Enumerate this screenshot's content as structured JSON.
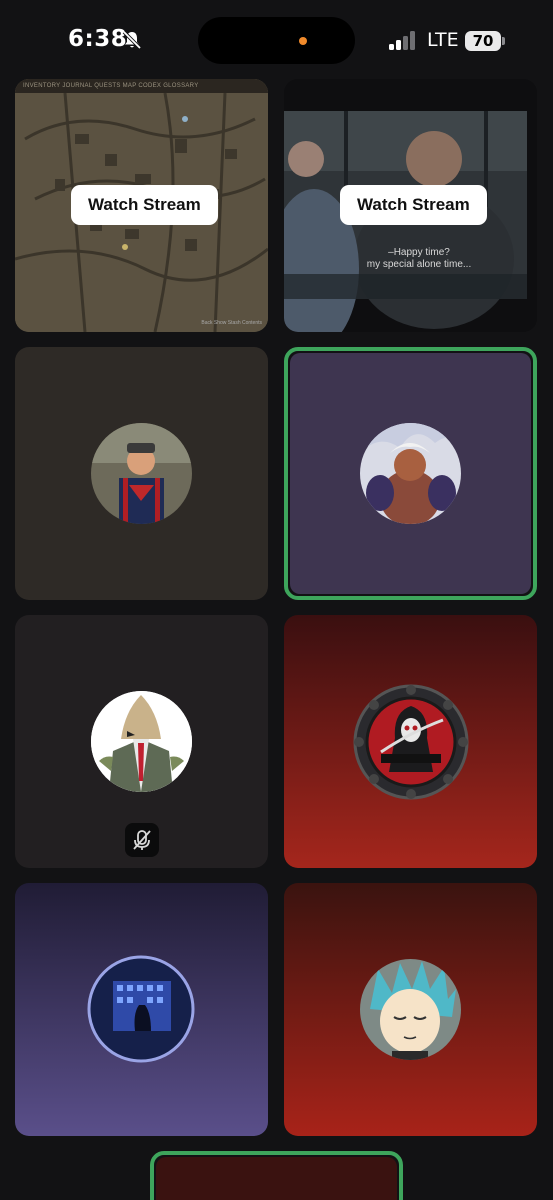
{
  "status_bar": {
    "time": "6:38",
    "carrier": "LTE",
    "battery": "70",
    "icons": [
      "bell-slash-icon",
      "cellular-signal-icon",
      "battery-icon"
    ]
  },
  "streams": [
    {
      "watch_label": "Watch Stream",
      "preview": "game-map",
      "map_tabs": "INVENTORY   JOURNAL   QUESTS   MAP   CODEX   GLOSSARY",
      "map_footer": "Back   Show Stash Contents"
    },
    {
      "watch_label": "Watch Stream",
      "preview": "video",
      "subtitle_line1": "–Happy time?",
      "subtitle_line2": "my special alone time..."
    }
  ],
  "participants": [
    {
      "avatar": "person-icon",
      "speaking": false,
      "muted": false
    },
    {
      "avatar": "person-icon",
      "speaking": true,
      "muted": false
    },
    {
      "avatar": "person-icon",
      "speaking": false,
      "muted": true
    },
    {
      "avatar": "reaper-logo-icon",
      "speaking": false,
      "muted": false
    },
    {
      "avatar": "moon-night-icon",
      "speaking": false,
      "muted": false
    },
    {
      "avatar": "person-icon",
      "speaking": false,
      "muted": false
    }
  ],
  "colors": {
    "speaking_ring": "#3ea55c",
    "background": "#121214"
  }
}
